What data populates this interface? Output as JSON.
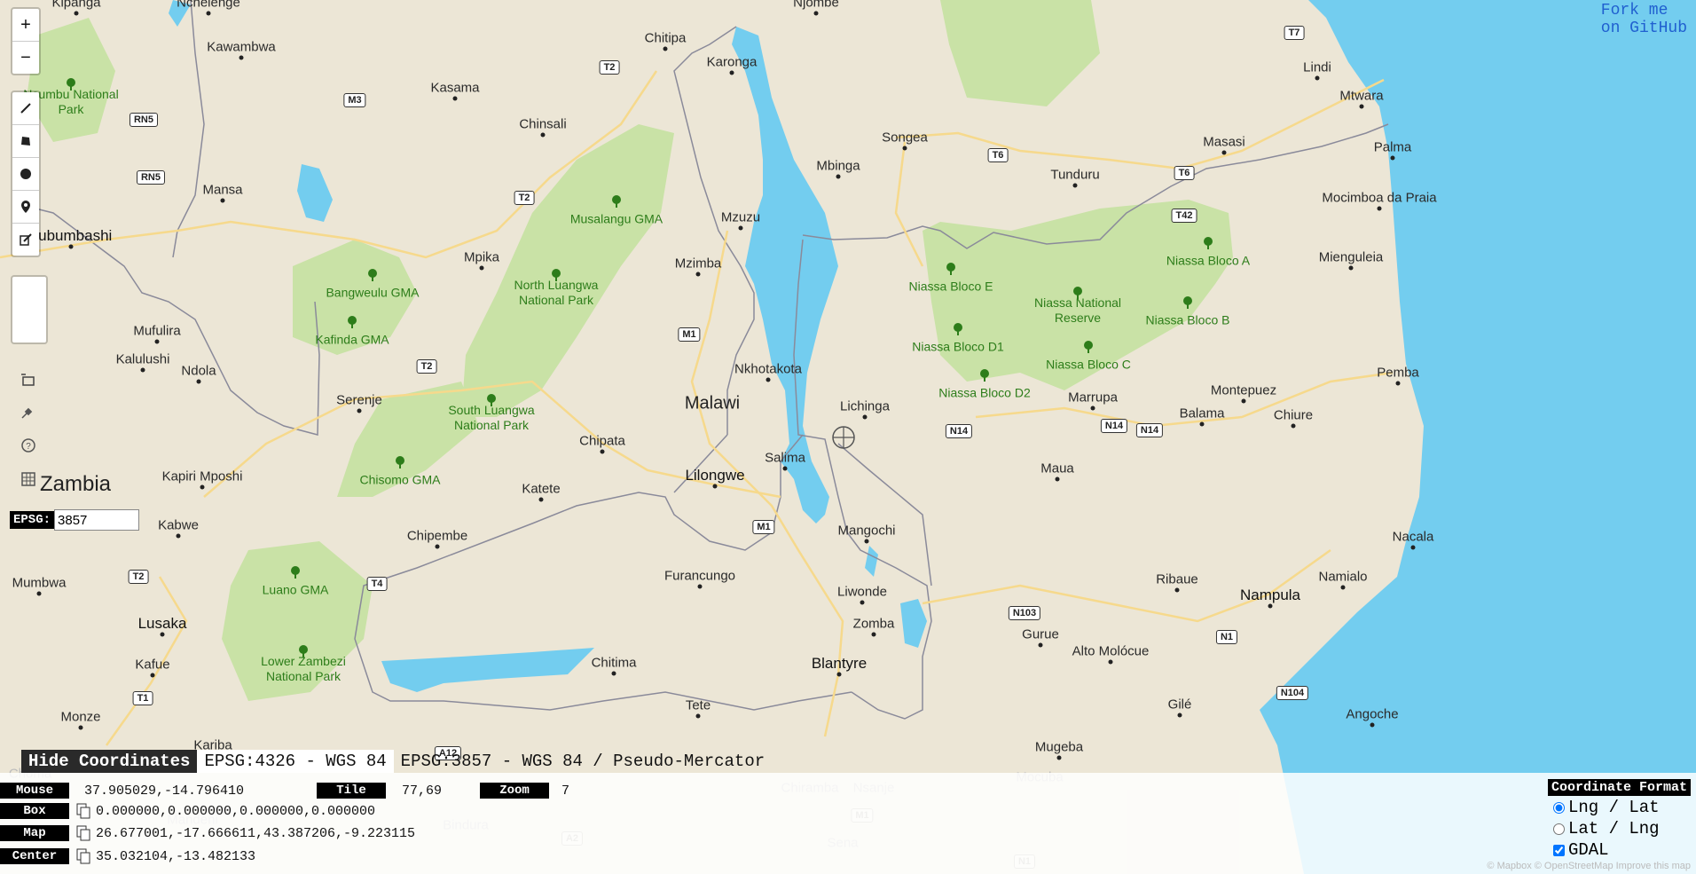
{
  "map": {
    "country_labels": [
      "Zambia",
      "Malawi"
    ],
    "cities": [
      {
        "name": "Kipanga"
      },
      {
        "name": "Nchelenge"
      },
      {
        "name": "Chitipa"
      },
      {
        "name": "Njombe"
      },
      {
        "name": "Kawambwa"
      },
      {
        "name": "Kasama"
      },
      {
        "name": "Karonga"
      },
      {
        "name": "Lindi"
      },
      {
        "name": "Mtwara"
      },
      {
        "name": "Chinsali"
      },
      {
        "name": "Songea"
      },
      {
        "name": "Masasi"
      },
      {
        "name": "Palma"
      },
      {
        "name": "Mbinga"
      },
      {
        "name": "Tunduru"
      },
      {
        "name": "Mansa"
      },
      {
        "name": "Lubumbashi"
      },
      {
        "name": "Mocimboa da Praia"
      },
      {
        "name": "Mzuzu"
      },
      {
        "name": "Mpika"
      },
      {
        "name": "Mzimba"
      },
      {
        "name": "Mienguleia"
      },
      {
        "name": "Mufulira"
      },
      {
        "name": "Kalulushi"
      },
      {
        "name": "Ndola"
      },
      {
        "name": "Nkhotakota"
      },
      {
        "name": "Pemba"
      },
      {
        "name": "Serenje"
      },
      {
        "name": "Lichinga"
      },
      {
        "name": "Montepuez"
      },
      {
        "name": "Marrupa"
      },
      {
        "name": "Balama"
      },
      {
        "name": "Chiure"
      },
      {
        "name": "Chipata"
      },
      {
        "name": "Salima"
      },
      {
        "name": "Lilongwe"
      },
      {
        "name": "Kapiri Mposhi"
      },
      {
        "name": "Katete"
      },
      {
        "name": "Maua"
      },
      {
        "name": "Kabwe"
      },
      {
        "name": "Mangochi"
      },
      {
        "name": "Nacala"
      },
      {
        "name": "Chipembe"
      },
      {
        "name": "Mumbwa"
      },
      {
        "name": "Furancungo"
      },
      {
        "name": "Liwonde"
      },
      {
        "name": "Ribaue"
      },
      {
        "name": "Namialo"
      },
      {
        "name": "Nampula"
      },
      {
        "name": "Zomba"
      },
      {
        "name": "Lusaka"
      },
      {
        "name": "Gurue"
      },
      {
        "name": "Kafue"
      },
      {
        "name": "Chitima"
      },
      {
        "name": "Blantyre"
      },
      {
        "name": "Alto Molócue"
      },
      {
        "name": "Tete"
      },
      {
        "name": "Gilé"
      },
      {
        "name": "Angoche"
      },
      {
        "name": "Monze"
      },
      {
        "name": "Kariba"
      },
      {
        "name": "Mugeba"
      },
      {
        "name": "Choma"
      },
      {
        "name": "Mocuba"
      },
      {
        "name": "Chiramba"
      },
      {
        "name": "Nsanje"
      },
      {
        "name": "Bindura"
      },
      {
        "name": "Sena"
      },
      {
        "name": "Mandeni"
      }
    ],
    "parks": [
      "Nsumbu National Park",
      "Musalangu GMA",
      "North Luangwa National Park",
      "Bangweulu GMA",
      "Kafinda GMA",
      "South Luangwa National Park",
      "Chisomo GMA",
      "Luano GMA",
      "Lower Zambezi National Park",
      "Niassa Bloco E",
      "Niassa National Reserve",
      "Niassa Bloco A",
      "Niassa Bloco B",
      "Niassa Bloco D1",
      "Niassa Bloco C",
      "Niassa Bloco D2"
    ],
    "roads": [
      "T7",
      "T2",
      "M3",
      "RN5",
      "RN5",
      "T6",
      "T6",
      "T42",
      "T2",
      "M1",
      "T2",
      "N14",
      "N14",
      "N14",
      "M1",
      "T2",
      "T4",
      "N103",
      "N1",
      "T1",
      "N104",
      "A12",
      "M1",
      "A2",
      "N1"
    ],
    "colors": {
      "land": "#ece6d6",
      "water": "#73cdef",
      "park": "#c9e2a6",
      "border": "#8a8a9a",
      "road": "#f6d98c"
    }
  },
  "toolbar": {
    "zoom_in": "+",
    "zoom_out": "−",
    "tools": [
      "draw-polyline-icon",
      "draw-polygon-icon",
      "draw-rectangle-icon",
      "draw-circle-icon",
      "draw-marker-icon",
      "edit-layers-icon",
      "delete-layers-icon"
    ],
    "extra": [
      "bounding-box-icon",
      "satellite-icon",
      "help-icon",
      "grid-icon"
    ]
  },
  "epsg": {
    "label": "EPSG:",
    "value": "3857"
  },
  "github": {
    "line1": "Fork me",
    "line2": "on GitHub"
  },
  "coords": {
    "hide_label": "Hide Coordinates",
    "tab1": "EPSG:4326 - WGS 84",
    "tab2": "EPSG:3857 - WGS 84 / Pseudo-Mercator",
    "mouse_key": "Mouse",
    "mouse_val": "37.905029,-14.796410",
    "tile_key": "Tile",
    "tile_val": "77,69",
    "zoom_key": "Zoom",
    "zoom_val": "7",
    "box_key": "Box",
    "box_val": "0.000000,0.000000,0.000000,0.000000",
    "map_key": "Map",
    "map_val": "26.677001,-17.666611,43.387206,-9.223115",
    "center_key": "Center",
    "center_val": "35.032104,-13.482133"
  },
  "format": {
    "title": "Coordinate Format",
    "opt1": "Lng / Lat",
    "opt2": "Lat / Lng",
    "opt3": "GDAL",
    "selected": "Lng / Lat",
    "gdal_checked": true
  },
  "attribution": "© Mapbox © OpenStreetMap Improve this map"
}
